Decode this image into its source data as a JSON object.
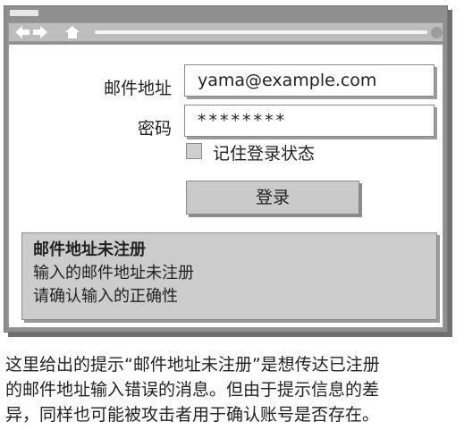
{
  "browser": {
    "icons": [
      "back-arrow-icon",
      "forward-arrow-icon",
      "home-icon"
    ]
  },
  "form": {
    "email_label": "邮件地址",
    "email_value": "yama@example.com",
    "password_label": "密码",
    "password_value": "********",
    "remember_label": "记住登录状态",
    "remember_checked": false,
    "login_button": "登录"
  },
  "message": {
    "title": "邮件地址未注册",
    "line1": "输入的邮件地址未注册",
    "line2": "请确认输入的正确性"
  },
  "caption": {
    "line1": "这里给出的提示“邮件地址未注册”是想传达已注册",
    "line2": "的邮件地址输入错误的消息。但由于提示信息的差",
    "line3": "异，同样也可能被攻击者用于确认账号是否存在。"
  }
}
